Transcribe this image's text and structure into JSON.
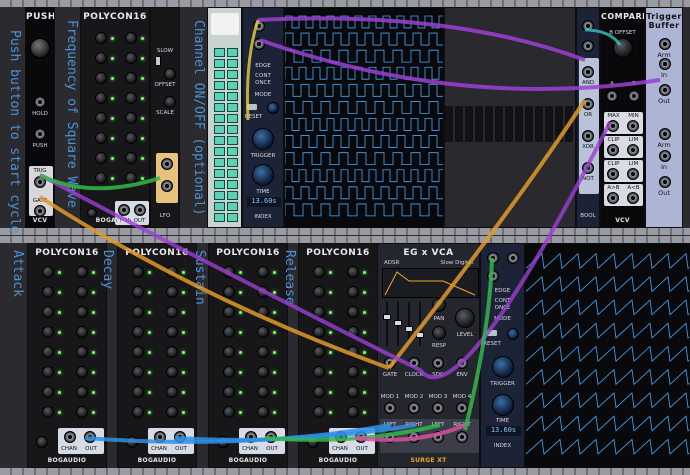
{
  "modules": {
    "push": {
      "title": "PUSH",
      "hold": "HOLD",
      "push": "PUSH",
      "trig": "TRIG",
      "gate": "GATE",
      "brand": "VCV"
    },
    "poly_top": {
      "title": "POLYCON16",
      "slow": "SLOW",
      "offset": "OFFSET",
      "scale": "SCALE",
      "lfo": "LFO",
      "chan": "CHAN",
      "out": "OUT",
      "brand": "BOGAUDIO",
      "reset": "RESET",
      "trig": "TRIG"
    },
    "poly_bottom": [
      {
        "title": "POLYCON16",
        "chan": "CHAN",
        "out": "OUT",
        "brand": "BOGAUDIO"
      },
      {
        "title": "POLYCON16",
        "chan": "CHAN",
        "out": "OUT",
        "brand": "BOGAUDIO"
      },
      {
        "title": "POLYCON16",
        "chan": "CHAN",
        "out": "OUT",
        "brand": "BOGAUDIO"
      },
      {
        "title": "POLYCON16",
        "chan": "CHAN",
        "out": "OUT",
        "brand": "BOGAUDIO"
      }
    ],
    "scope_top": {
      "ext_trig": "EXT.TR",
      "edge": "EDGE",
      "cont": "CONT",
      "once": "ONCE",
      "mode": "MODE",
      "reset": "RESET",
      "pre": "PRE",
      "trigger": "TRIGGER",
      "time": "TIME",
      "time_value": "13.60s",
      "index": "INDEX",
      "brand": "LINDENBERG"
    },
    "scope_bottom": {
      "ext_trig": "EXT.TR",
      "edge": "EDGE",
      "cont": "CONT",
      "once": "ONCE",
      "mode": "MODE",
      "reset": "RESET",
      "pre": "PRE",
      "trigger": "TRIGGER",
      "time": "TIME",
      "time_value": "13.60s",
      "index": "INDEX"
    },
    "bool": {
      "labels": [
        "AND",
        "OR",
        "XOR",
        "NOT"
      ],
      "brand": "BOOL"
    },
    "compare": {
      "title": "COMPARE",
      "b_offset": "B OFFSET",
      "a": "A",
      "b": "B",
      "rows": [
        [
          "MAX",
          "MIN"
        ],
        [
          "CLIP",
          "LIM"
        ],
        [
          "CLIP",
          "LIM"
        ],
        [
          "A>B",
          "A<B"
        ]
      ],
      "brand": "VCV"
    },
    "trigger_buffer": {
      "title": "Trigger Buffer",
      "arm": "Arm",
      "in": "In",
      "out": "Out"
    },
    "egvca": {
      "title": "EG x VCA",
      "adsr": "ADSR",
      "preset": "Slow Digital",
      "pan": "PAN",
      "resp": "RESP",
      "level": "LEVEL",
      "jacks": [
        "GATE",
        "CLOCK",
        "SDC",
        "ENV"
      ],
      "mods": [
        "MOD 1",
        "MOD 2",
        "MOD 3",
        "MOD 4"
      ],
      "outs": [
        "LEFT",
        "RIGHT",
        "LEFT",
        "RIGHT"
      ],
      "brand": "SURGE XT"
    }
  },
  "annotations": {
    "push": "Push button to start cycle",
    "freq": "Frequency of Square Wave",
    "channel": "Channel ON/OFF (optional)",
    "attack": "Attack",
    "decay": "Decay",
    "sustain": "Sustain",
    "release": "Release"
  },
  "cable_colors": {
    "orange": "#e09a2a",
    "purple": "#9b3fd2",
    "green": "#33b84a",
    "blue": "#2f8fe6",
    "white": "#eceef2",
    "yellow": "#e8d23a",
    "pink": "#d84fa0",
    "teal": "#35c4c4"
  }
}
